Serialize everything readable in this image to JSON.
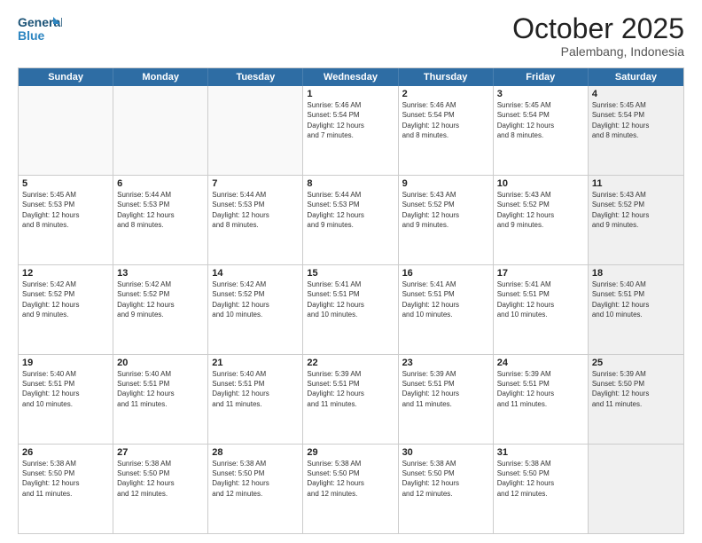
{
  "logo": {
    "line1": "General",
    "line2": "Blue"
  },
  "title": "October 2025",
  "location": "Palembang, Indonesia",
  "header_days": [
    "Sunday",
    "Monday",
    "Tuesday",
    "Wednesday",
    "Thursday",
    "Friday",
    "Saturday"
  ],
  "weeks": [
    [
      {
        "day": "",
        "text": "",
        "empty": true
      },
      {
        "day": "",
        "text": "",
        "empty": true
      },
      {
        "day": "",
        "text": "",
        "empty": true
      },
      {
        "day": "1",
        "text": "Sunrise: 5:46 AM\nSunset: 5:54 PM\nDaylight: 12 hours\nand 7 minutes.",
        "empty": false
      },
      {
        "day": "2",
        "text": "Sunrise: 5:46 AM\nSunset: 5:54 PM\nDaylight: 12 hours\nand 8 minutes.",
        "empty": false
      },
      {
        "day": "3",
        "text": "Sunrise: 5:45 AM\nSunset: 5:54 PM\nDaylight: 12 hours\nand 8 minutes.",
        "empty": false
      },
      {
        "day": "4",
        "text": "Sunrise: 5:45 AM\nSunset: 5:54 PM\nDaylight: 12 hours\nand 8 minutes.",
        "empty": false,
        "shaded": true
      }
    ],
    [
      {
        "day": "5",
        "text": "Sunrise: 5:45 AM\nSunset: 5:53 PM\nDaylight: 12 hours\nand 8 minutes.",
        "empty": false
      },
      {
        "day": "6",
        "text": "Sunrise: 5:44 AM\nSunset: 5:53 PM\nDaylight: 12 hours\nand 8 minutes.",
        "empty": false
      },
      {
        "day": "7",
        "text": "Sunrise: 5:44 AM\nSunset: 5:53 PM\nDaylight: 12 hours\nand 8 minutes.",
        "empty": false
      },
      {
        "day": "8",
        "text": "Sunrise: 5:44 AM\nSunset: 5:53 PM\nDaylight: 12 hours\nand 9 minutes.",
        "empty": false
      },
      {
        "day": "9",
        "text": "Sunrise: 5:43 AM\nSunset: 5:52 PM\nDaylight: 12 hours\nand 9 minutes.",
        "empty": false
      },
      {
        "day": "10",
        "text": "Sunrise: 5:43 AM\nSunset: 5:52 PM\nDaylight: 12 hours\nand 9 minutes.",
        "empty": false
      },
      {
        "day": "11",
        "text": "Sunrise: 5:43 AM\nSunset: 5:52 PM\nDaylight: 12 hours\nand 9 minutes.",
        "empty": false,
        "shaded": true
      }
    ],
    [
      {
        "day": "12",
        "text": "Sunrise: 5:42 AM\nSunset: 5:52 PM\nDaylight: 12 hours\nand 9 minutes.",
        "empty": false
      },
      {
        "day": "13",
        "text": "Sunrise: 5:42 AM\nSunset: 5:52 PM\nDaylight: 12 hours\nand 9 minutes.",
        "empty": false
      },
      {
        "day": "14",
        "text": "Sunrise: 5:42 AM\nSunset: 5:52 PM\nDaylight: 12 hours\nand 10 minutes.",
        "empty": false
      },
      {
        "day": "15",
        "text": "Sunrise: 5:41 AM\nSunset: 5:51 PM\nDaylight: 12 hours\nand 10 minutes.",
        "empty": false
      },
      {
        "day": "16",
        "text": "Sunrise: 5:41 AM\nSunset: 5:51 PM\nDaylight: 12 hours\nand 10 minutes.",
        "empty": false
      },
      {
        "day": "17",
        "text": "Sunrise: 5:41 AM\nSunset: 5:51 PM\nDaylight: 12 hours\nand 10 minutes.",
        "empty": false
      },
      {
        "day": "18",
        "text": "Sunrise: 5:40 AM\nSunset: 5:51 PM\nDaylight: 12 hours\nand 10 minutes.",
        "empty": false,
        "shaded": true
      }
    ],
    [
      {
        "day": "19",
        "text": "Sunrise: 5:40 AM\nSunset: 5:51 PM\nDaylight: 12 hours\nand 10 minutes.",
        "empty": false
      },
      {
        "day": "20",
        "text": "Sunrise: 5:40 AM\nSunset: 5:51 PM\nDaylight: 12 hours\nand 11 minutes.",
        "empty": false
      },
      {
        "day": "21",
        "text": "Sunrise: 5:40 AM\nSunset: 5:51 PM\nDaylight: 12 hours\nand 11 minutes.",
        "empty": false
      },
      {
        "day": "22",
        "text": "Sunrise: 5:39 AM\nSunset: 5:51 PM\nDaylight: 12 hours\nand 11 minutes.",
        "empty": false
      },
      {
        "day": "23",
        "text": "Sunrise: 5:39 AM\nSunset: 5:51 PM\nDaylight: 12 hours\nand 11 minutes.",
        "empty": false
      },
      {
        "day": "24",
        "text": "Sunrise: 5:39 AM\nSunset: 5:51 PM\nDaylight: 12 hours\nand 11 minutes.",
        "empty": false
      },
      {
        "day": "25",
        "text": "Sunrise: 5:39 AM\nSunset: 5:50 PM\nDaylight: 12 hours\nand 11 minutes.",
        "empty": false,
        "shaded": true
      }
    ],
    [
      {
        "day": "26",
        "text": "Sunrise: 5:38 AM\nSunset: 5:50 PM\nDaylight: 12 hours\nand 11 minutes.",
        "empty": false
      },
      {
        "day": "27",
        "text": "Sunrise: 5:38 AM\nSunset: 5:50 PM\nDaylight: 12 hours\nand 12 minutes.",
        "empty": false
      },
      {
        "day": "28",
        "text": "Sunrise: 5:38 AM\nSunset: 5:50 PM\nDaylight: 12 hours\nand 12 minutes.",
        "empty": false
      },
      {
        "day": "29",
        "text": "Sunrise: 5:38 AM\nSunset: 5:50 PM\nDaylight: 12 hours\nand 12 minutes.",
        "empty": false
      },
      {
        "day": "30",
        "text": "Sunrise: 5:38 AM\nSunset: 5:50 PM\nDaylight: 12 hours\nand 12 minutes.",
        "empty": false
      },
      {
        "day": "31",
        "text": "Sunrise: 5:38 AM\nSunset: 5:50 PM\nDaylight: 12 hours\nand 12 minutes.",
        "empty": false
      },
      {
        "day": "",
        "text": "",
        "empty": true,
        "shaded": true
      }
    ]
  ]
}
